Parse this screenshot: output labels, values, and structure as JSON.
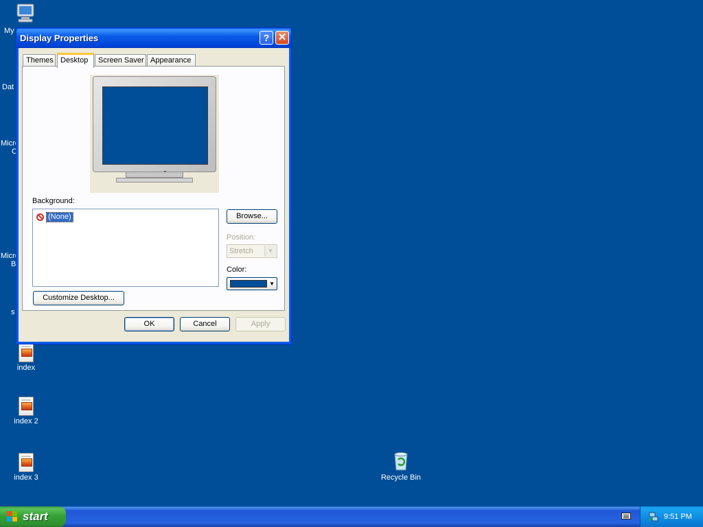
{
  "desktop": {
    "clipped_labels": [
      "My",
      "Dat",
      "Micro",
      "C",
      "Micro",
      "B",
      "s"
    ],
    "icons": [
      {
        "label": "index"
      },
      {
        "label": "index 2"
      },
      {
        "label": "index 3"
      },
      {
        "label": "Recycle Bin"
      }
    ]
  },
  "window": {
    "title": "Display Properties",
    "help_glyph": "?",
    "close_glyph": "✕",
    "tabs": [
      "Themes",
      "Desktop",
      "Screen Saver",
      "Appearance"
    ],
    "active_tab": "Desktop",
    "background_label": "Background:",
    "background_items": [
      "(None)"
    ],
    "browse_label": "Browse...",
    "position_label": "Position:",
    "position_value": "Stretch",
    "color_label": "Color:",
    "color_value": "#004e98",
    "customize_label": "Customize Desktop...",
    "ok_label": "OK",
    "cancel_label": "Cancel",
    "apply_label": "Apply"
  },
  "taskbar": {
    "start_label": "start",
    "clock": "9:51 PM"
  },
  "colors": {
    "desktop_bg": "#004e98",
    "titlebar": "#0a5ce8",
    "start_green": "#37a137"
  }
}
